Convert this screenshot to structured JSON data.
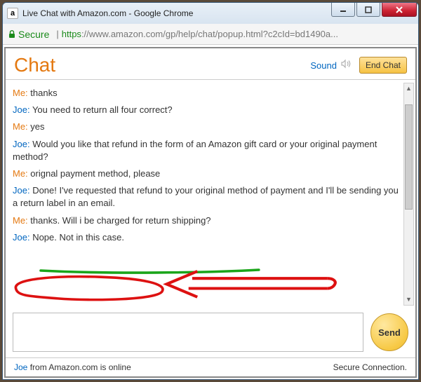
{
  "window": {
    "favicon_letter": "a",
    "title": "Live Chat with Amazon.com - Google Chrome"
  },
  "address": {
    "secure_label": "Secure",
    "url_https": "https",
    "url_rest": "://www.amazon.com/gp/help/chat/popup.html?c2cId=bd1490a..."
  },
  "header": {
    "title": "Chat",
    "sound_label": "Sound",
    "end_chat_label": "End Chat"
  },
  "messages": [
    {
      "sender": "Me:",
      "sender_class": "sender-me",
      "text": "thanks"
    },
    {
      "sender": "Joe:",
      "sender_class": "sender-agent",
      "text": "You need to return all four correct?"
    },
    {
      "sender": "Me:",
      "sender_class": "sender-me",
      "text": "yes"
    },
    {
      "sender": "Joe:",
      "sender_class": "sender-agent",
      "text": "Would you like that refund in the form of an Amazon gift card or your original payment method?"
    },
    {
      "sender": "Me:",
      "sender_class": "sender-me",
      "text": "orignal payment method, please"
    },
    {
      "sender": "Joe:",
      "sender_class": "sender-agent",
      "text": "Done! I've requested that refund to your original method of payment and I'll be sending you a return label in an email."
    },
    {
      "sender": "Me:",
      "sender_class": "sender-me",
      "text": "thanks. Will i be charged for return shipping?"
    },
    {
      "sender": "Joe:",
      "sender_class": "sender-agent",
      "text": "Nope. Not in this case."
    }
  ],
  "input": {
    "send_label": "Send"
  },
  "footer": {
    "agent_name": "Joe",
    "status_suffix": " from Amazon.com is online",
    "secure": "Secure Connection."
  },
  "annotation": {
    "color_red": "#d11",
    "color_green": "#1aa51a"
  }
}
